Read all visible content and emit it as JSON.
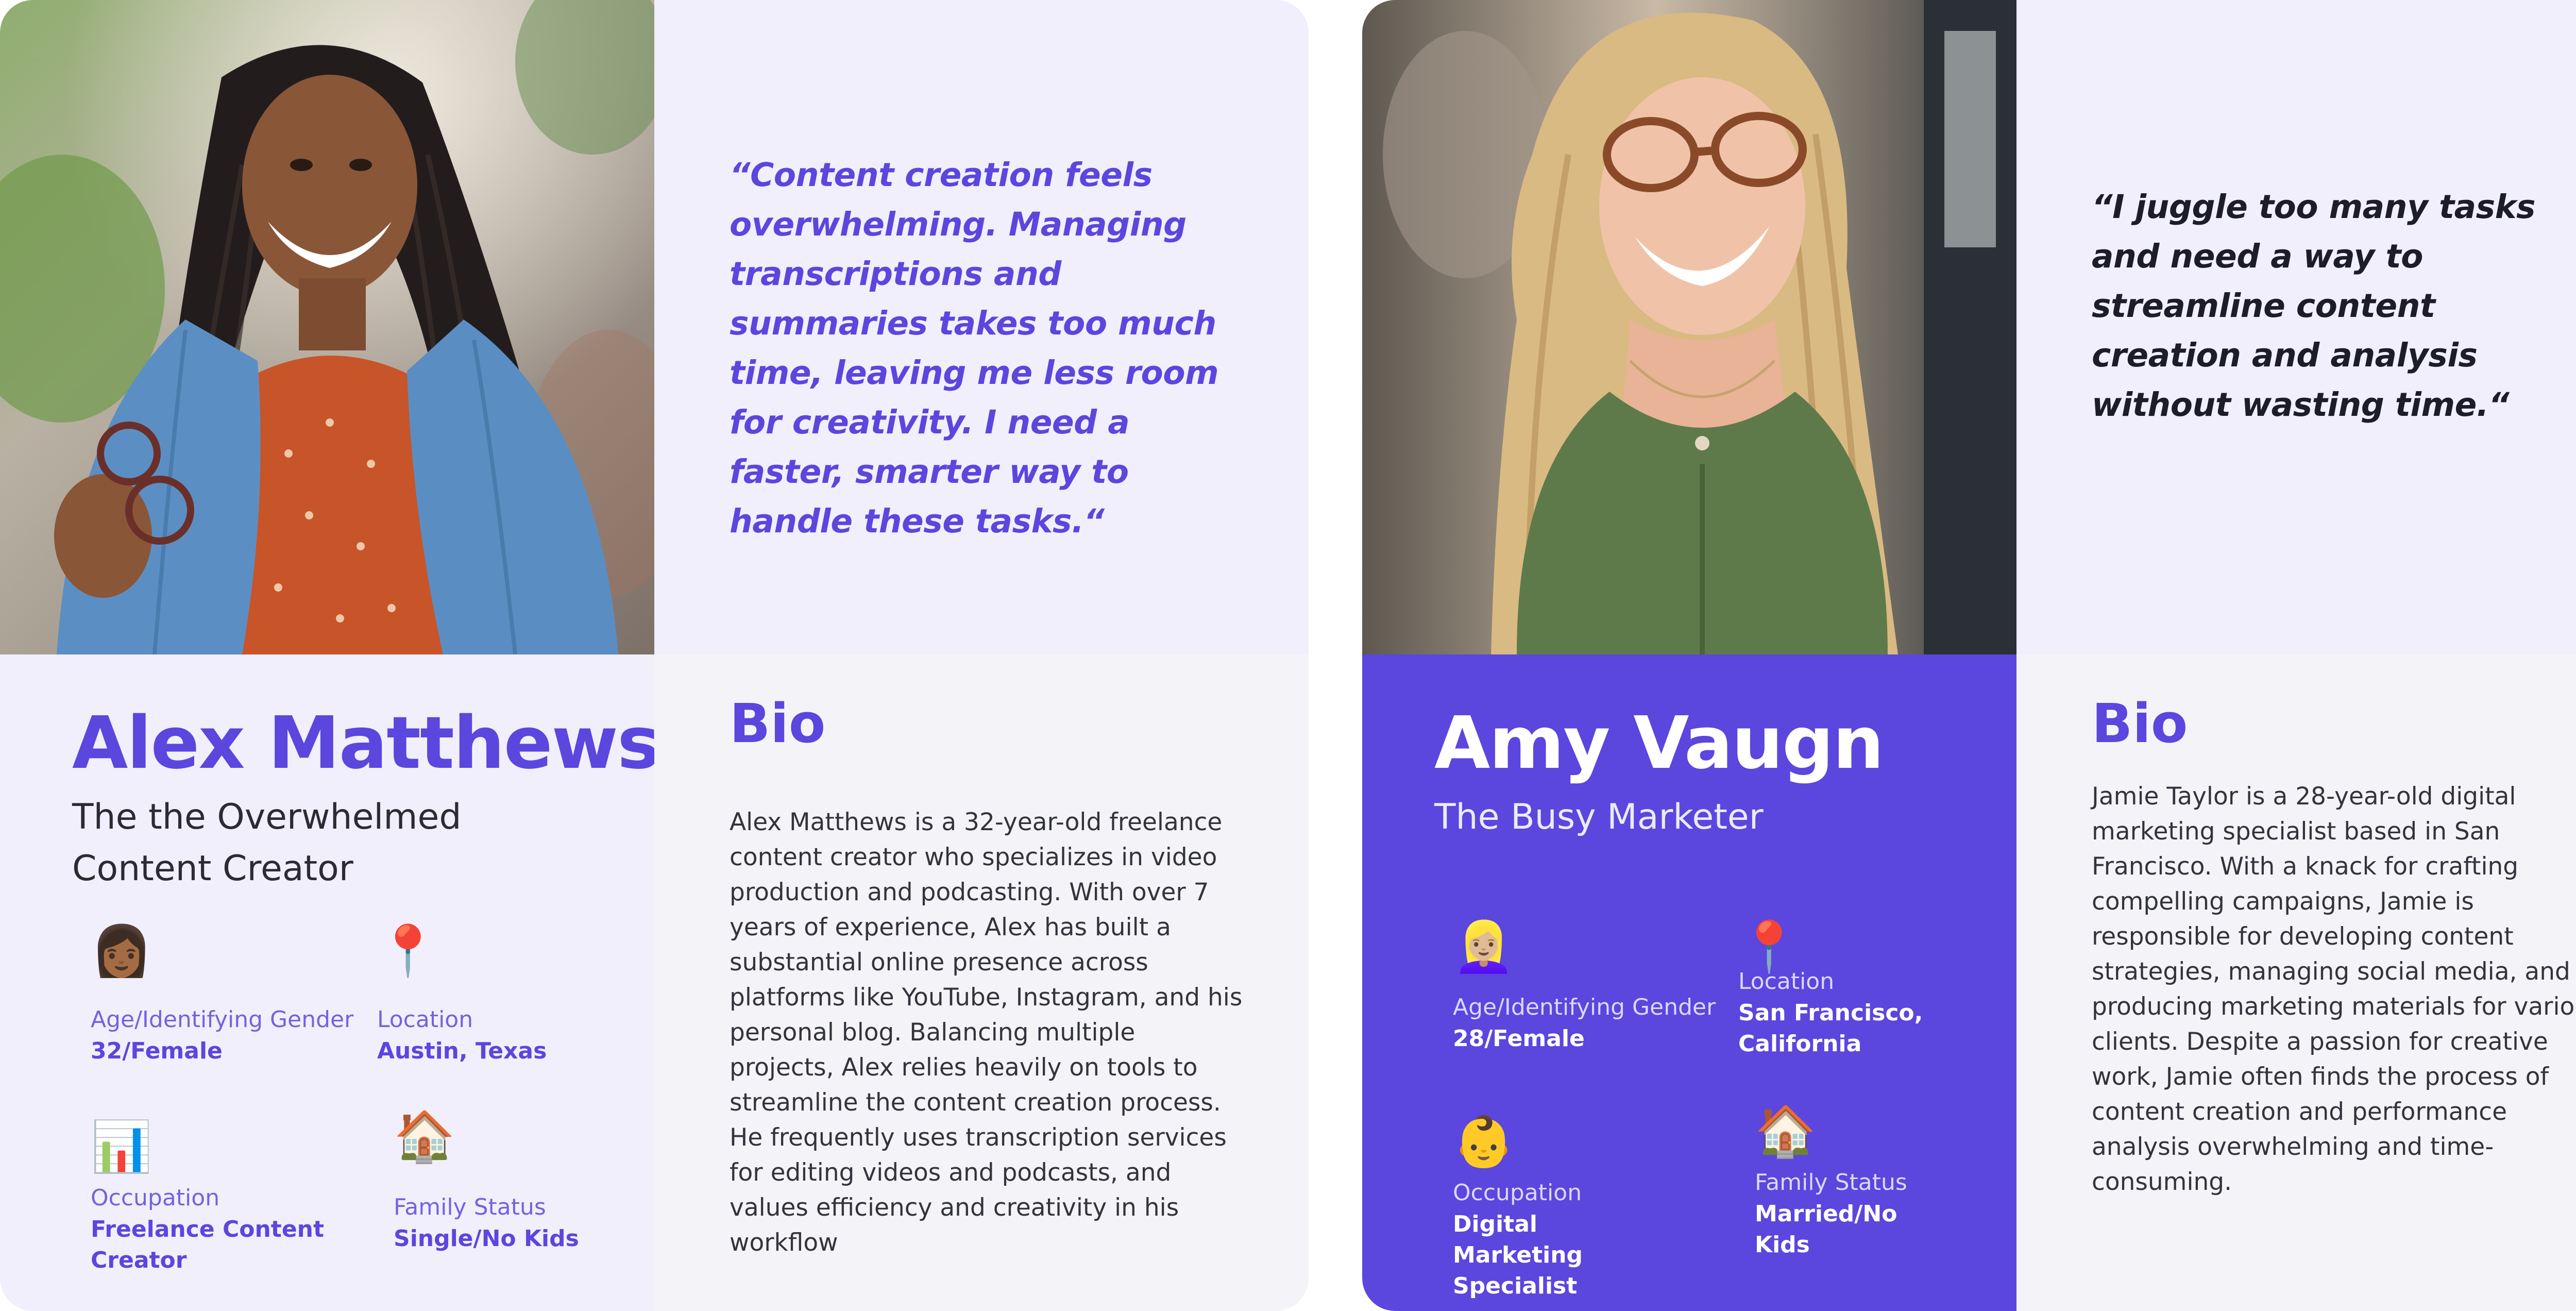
{
  "personas": [
    {
      "quote": "“Content creation feels overwhelming. Managing transcriptions and summaries takes too much time, leaving me less room for creativity. I need a faster, smarter way to handle these tasks.“",
      "name": "Alex Matthews",
      "subtitle": "The the Overwhelmed Content Creator",
      "photo_icon": "woman-portrait-photo",
      "attributes": [
        {
          "icon": "woman-medium-skin-emoji",
          "glyph": "👩🏾",
          "label": "Age/Identifying Gender",
          "value": "32/Female"
        },
        {
          "icon": "round-pushpin-emoji",
          "glyph": "📍",
          "label": "Location",
          "value": "Austin, Texas"
        },
        {
          "icon": "bar-chart-emoji",
          "glyph": "📊",
          "label": "Occupation",
          "value": "Freelance Content Creator"
        },
        {
          "icon": "house-emoji",
          "glyph": "🏠",
          "label": "Family Status",
          "value": "Single/No Kids"
        }
      ],
      "bio_title": "Bio",
      "bio": "Alex Matthews is a 32-year-old freelance content creator who specializes in video production and podcasting. With over 7 years of experience, Alex has built a substantial online presence across platforms like YouTube, Instagram, and his personal blog. Balancing multiple projects, Alex relies heavily on tools to streamline the content creation process. He frequently uses transcription services for editing videos and podcasts, and values efficiency and creativity in his workflow"
    },
    {
      "quote": "“I juggle too many tasks and need a way to streamline content creation and analysis without wasting time.“",
      "name": "Amy Vaugn",
      "subtitle": "The Busy Marketer",
      "photo_icon": "woman-glasses-portrait-photo",
      "attributes": [
        {
          "icon": "blond-woman-emoji",
          "glyph": "👱🏼‍♀️",
          "label": "Age/Identifying Gender",
          "value": "28/Female"
        },
        {
          "icon": "round-pushpin-emoji",
          "glyph": "📍",
          "label": "Location",
          "value": "San Francisco, California"
        },
        {
          "icon": "baby-emoji",
          "glyph": "👶",
          "label": "Occupation",
          "value": "Digital Marketing Specialist"
        },
        {
          "icon": "house-emoji",
          "glyph": "🏠",
          "label": "Family Status",
          "value": "Married/No Kids"
        }
      ],
      "bio_title": "Bio",
      "bio": "Jamie Taylor is a 28-year-old digital marketing specialist based in San Francisco. With a knack for crafting compelling campaigns, Jamie is responsible for developing content strategies, managing social media, and producing marketing materials for various clients. Despite a passion for creative work, Jamie often finds the process of content creation and performance analysis overwhelming and time-consuming."
    }
  ],
  "colors": {
    "accent": "#5b46de",
    "panel_light": "#f1effb",
    "panel_bio": "#f4f4f8",
    "text_dark": "#1c1c2a"
  }
}
